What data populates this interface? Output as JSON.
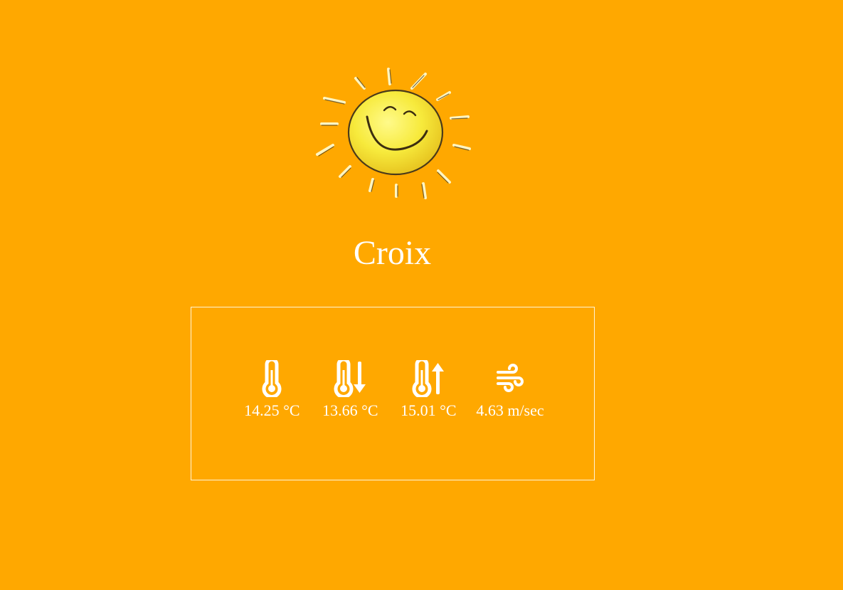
{
  "weather": {
    "icon": "sun-icon",
    "city": "Croix",
    "metrics": [
      {
        "icon": "thermometer-icon",
        "value": "14.25 °C"
      },
      {
        "icon": "thermometer-down-icon",
        "value": "13.66 °C"
      },
      {
        "icon": "thermometer-up-icon",
        "value": "15.01 °C"
      },
      {
        "icon": "wind-icon",
        "value": "4.63 m/sec"
      }
    ]
  },
  "colors": {
    "background": "#ffa800",
    "text": "#ffffff",
    "box_border": "#fff4d6",
    "sun_fill": "#f4e84a",
    "sun_outline": "#4a3a1a"
  }
}
